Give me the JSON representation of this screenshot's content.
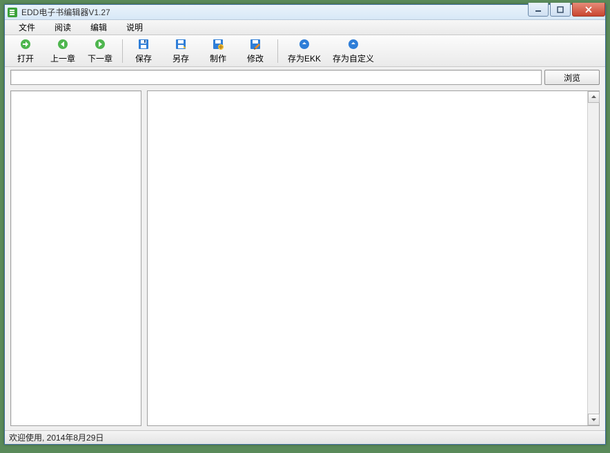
{
  "window": {
    "title": "EDD电子书编辑器V1.27"
  },
  "menu": {
    "file": "文件",
    "read": "阅读",
    "edit": "编辑",
    "help": "说明"
  },
  "toolbar": {
    "open": "打开",
    "prev": "上一章",
    "next": "下一章",
    "save": "保存",
    "save_as": "另存",
    "build": "制作",
    "modify": "修改",
    "save_ekk": "存为EKK",
    "save_custom": "存为自定义"
  },
  "path": {
    "value": "",
    "browse_label": "浏览"
  },
  "status": {
    "text": "欢迎使用, 2014年8月29日"
  }
}
